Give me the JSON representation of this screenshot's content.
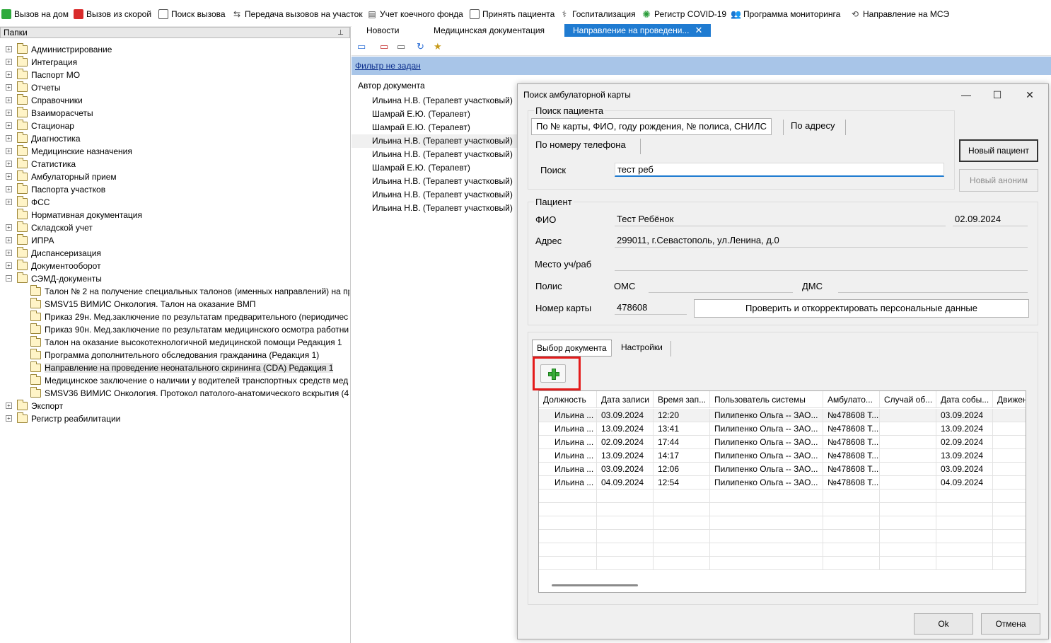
{
  "toolbar": {
    "items": [
      {
        "label": "Вызов на дом",
        "icon": "house-call-icon"
      },
      {
        "label": "Вызов из скорой",
        "icon": "ambulance-icon"
      },
      {
        "label": "Поиск вызова",
        "icon": "search-call-icon"
      },
      {
        "label": "Передача вызовов на участок",
        "icon": "transfer-icon"
      },
      {
        "label": "Учет коечного фонда",
        "icon": "bed-icon"
      },
      {
        "label": "Принять пациента",
        "icon": "accept-patient-icon"
      },
      {
        "label": "Госпитализация",
        "icon": "hospitalization-icon"
      },
      {
        "label": "Регистр COVID-19",
        "icon": "virus-icon"
      },
      {
        "label": "Программа мониторинга",
        "icon": "monitoring-icon"
      },
      {
        "label": "Направление на МСЭ",
        "icon": "mse-icon"
      }
    ]
  },
  "left_pane": {
    "title": "Папки",
    "tree": [
      "Администрирование",
      "Интеграция",
      "Паспорт МО",
      "Отчеты",
      "Справочники",
      "Взаиморасчеты",
      "Стационар",
      "Диагностика",
      "Медицинские назначения",
      "Статистика",
      "Амбулаторный прием",
      "Паспорта участков",
      "ФСС",
      "Нормативная документация",
      "Складской учет",
      "ИПРА",
      "Диспансеризация",
      "Документооборот",
      "СЭМД-документы"
    ],
    "semd_children": [
      "Талон № 2 на получение специальных талонов (именных направлений) на пр",
      "SMSV15 ВИМИС Онкология. Талон на оказание ВМП",
      "Приказ 29н. Мед.заключение по результатам предварительного (периодичес",
      "Приказ 90н. Мед.заключение по результатам медицинского осмотра работни",
      "Талон на оказание высокотехнологичной медицинской помощи Редакция 1",
      "Программа дополнительного обследования гражданина (Редакция 1)",
      "Направление на проведение неонатального скрининга (CDA) Редакция 1",
      "Медицинское заключение о наличии у водителей транспортных средств мед",
      "SMSV36 ВИМИС Онкология. Протокол патолого-анатомического вскрытия (4"
    ],
    "tail": [
      "Экспорт",
      "Регистр реабилитации"
    ]
  },
  "tabs": {
    "news": "Новости",
    "med_docs": "Медицинская документация",
    "active": "Направление на проведени...",
    "close": "✕"
  },
  "filter": {
    "label": "Фильтр не задан"
  },
  "authors": {
    "column": "Автор документа",
    "rows": [
      "Ильина Н.В. (Терапевт участковый)",
      "Шамрай Е.Ю. (Терапевт)",
      "Шамрай Е.Ю. (Терапевт)",
      "Ильина Н.В. (Терапевт участковый)",
      "Ильина Н.В. (Терапевт участковый)",
      "Шамрай Е.Ю. (Терапевт)",
      "Ильина Н.В. (Терапевт участковый)",
      "Ильина Н.В. (Терапевт участковый)",
      "Ильина Н.В. (Терапевт участковый)"
    ]
  },
  "dialog": {
    "title": "Поиск амбулаторной карты",
    "search_group": "Поиск пациента",
    "seg_main": "По № карты, ФИО, году рождения, № полиса, СНИЛС",
    "seg_address": "По адресу",
    "seg_phone": "По номеру телефона",
    "search_label": "Поиск",
    "search_value": "тест реб",
    "btn_new_patient": "Новый пациент",
    "btn_new_anon": "Новый аноним",
    "patient_group": "Пациент",
    "fio_label": "ФИО",
    "fio_value": "Тест Ребёнок",
    "birth_date": "02.09.2024",
    "address_label": "Адрес",
    "address_value": "299011, г.Севастополь, ул.Ленина, д.0",
    "workplace_label": "Место уч/раб",
    "workplace_value": "",
    "policy_label": "Полис",
    "oms_label": "ОМС",
    "oms_value": "",
    "dms_label": "ДМС",
    "dms_value": "",
    "card_label": "Номер карты",
    "card_value": "478608",
    "check_button": "Проверить и откорректировать персональные данные",
    "tab_select_doc": "Выбор документа",
    "tab_settings": "Настройки",
    "ok": "Ok",
    "cancel": "Отмена"
  },
  "grid": {
    "columns": [
      "Должность",
      "Дата записи",
      "Время зап...",
      "Пользователь системы",
      "Амбулато...",
      "Случай об...",
      "Дата собы...",
      "Движен"
    ],
    "rows": [
      [
        "Ильина ...",
        "03.09.2024",
        "12:20",
        "Пилипенко Ольга -- ЗАО...",
        "№478608 Т...",
        "",
        "03.09.2024",
        ""
      ],
      [
        "Ильина ...",
        "13.09.2024",
        "13:41",
        "Пилипенко Ольга -- ЗАО...",
        "№478608 Т...",
        "",
        "13.09.2024",
        ""
      ],
      [
        "Ильина ...",
        "02.09.2024",
        "17:44",
        "Пилипенко Ольга -- ЗАО...",
        "№478608 Т...",
        "",
        "02.09.2024",
        ""
      ],
      [
        "Ильина ...",
        "13.09.2024",
        "14:17",
        "Пилипенко Ольга -- ЗАО...",
        "№478608 Т...",
        "",
        "13.09.2024",
        ""
      ],
      [
        "Ильина ...",
        "03.09.2024",
        "12:06",
        "Пилипенко Ольга -- ЗАО...",
        "№478608 Т...",
        "",
        "03.09.2024",
        ""
      ],
      [
        "Ильина ...",
        "04.09.2024",
        "12:54",
        "Пилипенко Ольга -- ЗАО...",
        "№478608 Т...",
        "",
        "04.09.2024",
        ""
      ]
    ]
  },
  "colors": {
    "accent": "#1f7bd1",
    "filter_bar": "#a8c5e8",
    "highlight": "#e41b1b",
    "add_green": "#3bae3b"
  }
}
